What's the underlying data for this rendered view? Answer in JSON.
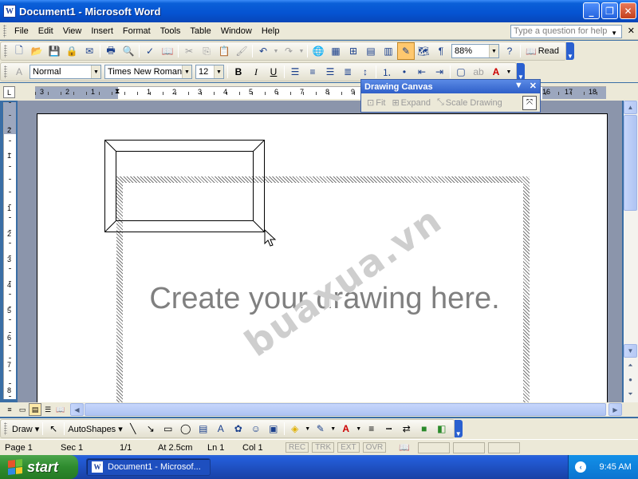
{
  "window": {
    "title": "Document1 - Microsoft Word",
    "app_icon_text": "W",
    "minimize": "_",
    "maximize": "❐",
    "close": "✕"
  },
  "menu": {
    "items": [
      "File",
      "Edit",
      "View",
      "Insert",
      "Format",
      "Tools",
      "Table",
      "Window",
      "Help"
    ],
    "help_placeholder": "Type a question for help",
    "doc_close": "✕"
  },
  "standard_toolbar": {
    "zoom": "88%",
    "read_label": "Read"
  },
  "formatting_toolbar": {
    "style": "Normal",
    "font": "Times New Roman",
    "size": "12",
    "bold": "B",
    "italic": "I",
    "underline": "U"
  },
  "ruler": {
    "tab_glyph": "L",
    "numbers": [
      "3",
      "2",
      "1",
      "1",
      "2",
      "3",
      "4",
      "5",
      "6",
      "7",
      "8",
      "9",
      "16",
      "17",
      "18"
    ],
    "vnumbers": [
      "2",
      "1",
      "1",
      "2",
      "3",
      "4",
      "5",
      "6",
      "7",
      "8"
    ]
  },
  "drawing_canvas_toolbar": {
    "title": "Drawing Canvas",
    "fit": "Fit",
    "expand": "Expand",
    "scale": "Scale Drawing"
  },
  "document": {
    "canvas_text": "Create your drawing here.",
    "watermark": "buaxua.vn"
  },
  "drawing_toolbar": {
    "draw_label": "Draw",
    "autoshapes_label": "AutoShapes"
  },
  "status": {
    "page": "Page  1",
    "sec": "Sec  1",
    "pages": "1/1",
    "at": "At  2.5cm",
    "ln": "Ln  1",
    "col": "Col  1",
    "rec": "REC",
    "trk": "TRK",
    "ext": "EXT",
    "ovr": "OVR"
  },
  "taskbar": {
    "start": "start",
    "task_label": "Document1 - Microsof...",
    "clock": "9:45 AM"
  }
}
